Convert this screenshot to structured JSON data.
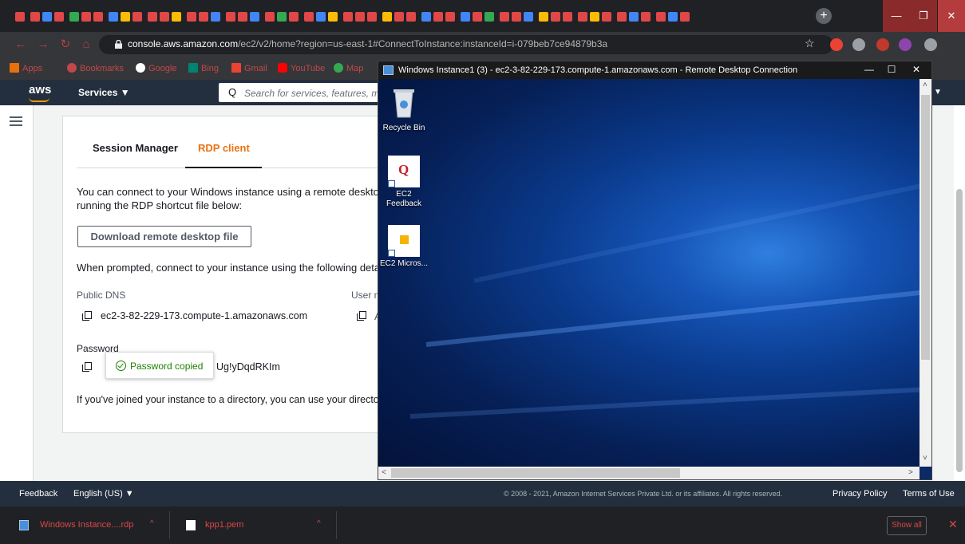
{
  "browser": {
    "url_host": "console.aws.amazon.com",
    "url_rest": "/ec2/v2/home?region=us-east-1#ConnectToInstance:instanceId=i-079beb7ce94879b3a",
    "new_tab_label": "+",
    "window_controls": [
      "—",
      "❐",
      "✕"
    ],
    "tab_favicon_colors": [
      "#e04848",
      "#e04848",
      "#4285f4",
      "#e04848",
      "#34a853",
      "#e04848",
      "#e04848",
      "#4285f4",
      "#fbbc05",
      "#e04848",
      "#e04848",
      "#e04848",
      "#fbbc05",
      "#e04848",
      "#e04848",
      "#4285f4"
    ],
    "nav_glyphs": {
      "back": "←",
      "forward": "→",
      "reload": "↻",
      "home": "⌂",
      "star": "☆"
    },
    "extension_colors": [
      "#ea4335",
      "#9aa0a6",
      "#c0392b",
      "#8e44ad",
      "#9aa0a6"
    ]
  },
  "bookmarks": {
    "apps": "Apps",
    "items": [
      "Bookmarks",
      "Google",
      "Bing",
      "Gmail",
      "YouTube",
      "Map"
    ]
  },
  "aws_header": {
    "logo": "aws",
    "services": "Services ▼",
    "search_placeholder": "Search for services, features, m",
    "search_glyph": "Q",
    "caret": "▼"
  },
  "connect": {
    "tabs": [
      "Session Manager",
      "RDP client"
    ],
    "intro_line1": "You can connect to your Windows instance using a remote desktop",
    "intro_line2": "running the RDP shortcut file below:",
    "download_button": "Download remote desktop file",
    "prompted": "When prompted, connect to your instance using the following detai",
    "public_dns_label": "Public DNS",
    "public_dns_value": "ec2-3-82-229-173.compute-1.amazonaws.com",
    "user_label": "User n",
    "user_value_glyph": "A",
    "password_label": "Password",
    "password_tail": "Ug!yDqdRKIm",
    "popover": "Password copied",
    "directory": "If you've joined your instance to a directory, you can use your directo"
  },
  "rdp_window": {
    "title": "Windows Instance1 (3) - ec2-3-82-229-173.compute-1.amazonaws.com - Remote Desktop Connection",
    "controls": [
      "—",
      "☐",
      "✕"
    ],
    "desktop_icons": [
      {
        "label": "Recycle Bin"
      },
      {
        "label": "EC2 Feedback",
        "glyph": "Q"
      },
      {
        "label": "EC2 Micros..."
      }
    ],
    "scroll_glyphs": {
      "up": "˄",
      "down": "˅",
      "left": "<",
      "right": ">"
    }
  },
  "footer": {
    "feedback": "Feedback",
    "language": "English (US) ▼",
    "copyright": "© 2008 - 2021, Amazon Internet Services Private Ltd. or its affiliates. All rights reserved.",
    "privacy": "Privacy Policy",
    "terms": "Terms of Use"
  },
  "downloads": {
    "items": [
      {
        "name": "Windows Instance....rdp"
      },
      {
        "name": "kpp1.pem"
      }
    ],
    "caret": "^",
    "show_all": "Show all",
    "close": "✕"
  }
}
